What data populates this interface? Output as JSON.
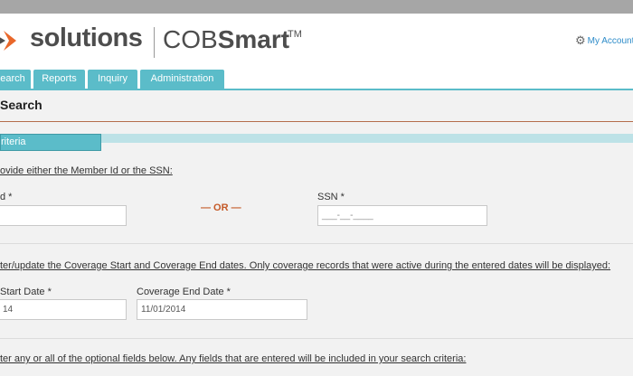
{
  "header": {
    "logo_solutions": "solutions",
    "logo_cob": "COB",
    "logo_smart": "Smart",
    "logo_tm": "TM",
    "account_link": "My Account",
    "account_icon": "gear-icon"
  },
  "nav": {
    "tabs": [
      {
        "label": "earch"
      },
      {
        "label": "Reports"
      },
      {
        "label": "Inquiry"
      },
      {
        "label": "Administration"
      }
    ]
  },
  "page": {
    "title": "Search"
  },
  "criteria": {
    "tab_label": "riteria",
    "member_note": "ovide either the Member Id or the SSN:",
    "member_id_label": "d *",
    "member_id_value": "",
    "or_text": "— OR —",
    "ssn_label": "SSN *",
    "ssn_placeholder": "___-__-____",
    "coverage_note": "ter/update the Coverage Start and Coverage End dates. Only coverage records that were active during the entered dates will be displayed:",
    "coverage_start_label": "Start Date *",
    "coverage_start_value": "14",
    "coverage_end_label": "Coverage End Date *",
    "coverage_end_value": "11/01/2014",
    "optional_note": "ter any or all of the optional fields below. Any fields that are entered will be included in your search criteria:"
  },
  "colors": {
    "accent_teal": "#5bbcc9",
    "or_orange": "#c55a28",
    "link_blue": "#2e8cc9"
  }
}
